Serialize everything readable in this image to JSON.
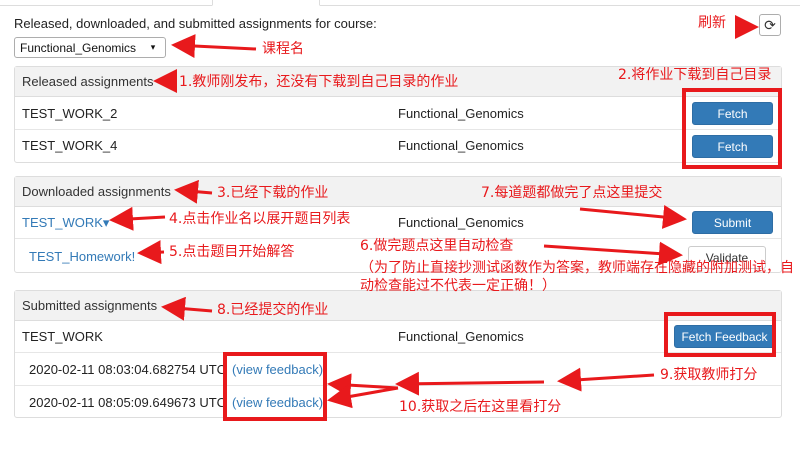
{
  "header": {
    "intro": "Released, downloaded, and submitted assignments for course:",
    "course_value": "Functional_Genomics",
    "caret": "▾",
    "refresh_icon": "refresh-icon"
  },
  "released": {
    "heading": "Released assignments",
    "rows": [
      {
        "name": "TEST_WORK_2",
        "course": "Functional_Genomics",
        "button": "Fetch"
      },
      {
        "name": "TEST_WORK_4",
        "course": "Functional_Genomics",
        "button": "Fetch"
      }
    ]
  },
  "downloaded": {
    "heading": "Downloaded assignments",
    "assignment": {
      "name": "TEST_WORK",
      "caret": "▾",
      "course": "Functional_Genomics",
      "button": "Submit"
    },
    "notebook": {
      "name": "TEST_Homework!",
      "button": "Validate"
    }
  },
  "submitted": {
    "heading": "Submitted assignments",
    "assignment": {
      "name": "TEST_WORK",
      "course": "Functional_Genomics",
      "button": "Fetch Feedback"
    },
    "entries": [
      {
        "timestamp": "2020-02-11 08:03:04.682754 UTC",
        "link": "(view feedback)"
      },
      {
        "timestamp": "2020-02-11 08:05:09.649673 UTC",
        "link": "(view feedback)"
      }
    ]
  },
  "annotations": {
    "refresh": "刷新",
    "course_name": "课程名",
    "a1": "1.教师刚发布，还没有下载到自己目录的作业",
    "a2": "2.将作业下载到自己目录",
    "a3": "3.已经下载的作业",
    "a4": "4.点击作业名以展开题目列表",
    "a5": "5.点击题目开始解答",
    "a6": "6.做完题点这里自动检查",
    "a6_note": "（为了防止直接抄测试函数作为答案，教师端存在隐藏的附加测试，自动检查能过不代表一定正确！）",
    "a7": "7.每道题都做完了点这里提交",
    "a8": "8.已经提交的作业",
    "a9": "9.获取教师打分",
    "a10": "10.获取之后在这里看打分"
  },
  "colors": {
    "annotation": "#e8191c",
    "primary": "#337ab7",
    "heading_bg": "#f2f2f2"
  }
}
